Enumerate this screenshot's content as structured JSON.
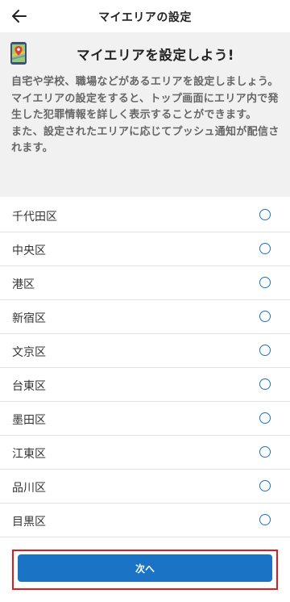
{
  "header": {
    "title": "マイエリアの設定",
    "back_icon": "back-arrow-icon"
  },
  "intro": {
    "icon": "map-pin-icon",
    "title": "マイエリアを設定しよう!",
    "paragraphs": [
      "自宅や学校、職場などがあるエリアを設定しましょう。",
      "マイエリアの設定をすると、トップ画面にエリア内で発生した犯罪情報を詳しく表示することができます。",
      "また、設定されたエリアに応じてプッシュ通知が配信されます。"
    ]
  },
  "areas": [
    {
      "name": "千代田区",
      "selected": false
    },
    {
      "name": "中央区",
      "selected": false
    },
    {
      "name": "港区",
      "selected": false
    },
    {
      "name": "新宿区",
      "selected": false
    },
    {
      "name": "文京区",
      "selected": false
    },
    {
      "name": "台東区",
      "selected": false
    },
    {
      "name": "墨田区",
      "selected": false
    },
    {
      "name": "江東区",
      "selected": false
    },
    {
      "name": "品川区",
      "selected": false
    },
    {
      "name": "目黒区",
      "selected": false
    }
  ],
  "footer": {
    "next_label": "次へ"
  },
  "colors": {
    "accent": "#1a73c4",
    "highlight": "#e01b1b",
    "intro_background": "#f1f1f1"
  }
}
